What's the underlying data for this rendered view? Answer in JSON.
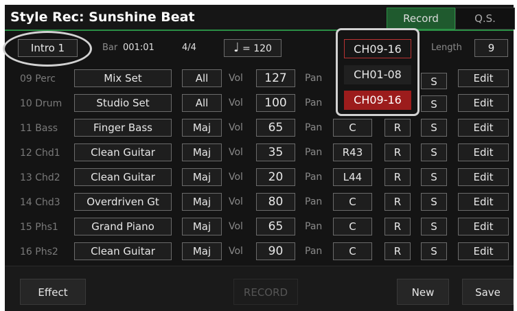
{
  "window": {
    "title": "Style Rec: Sunshine Beat"
  },
  "tabs": {
    "record": "Record",
    "qs": "Q.S."
  },
  "top": {
    "section": "Intro 1",
    "bar_label": "Bar",
    "bar_value": "001:01",
    "time_sig": "4/4",
    "tempo_symbol": "♩",
    "tempo_text": "= 120",
    "channel_range": "CH09-16",
    "length_label": "Length",
    "length_value": "9"
  },
  "channel_dropdown": {
    "options": [
      "CH01-08",
      "CH09-16"
    ],
    "selected": "CH09-16"
  },
  "labels": {
    "vol": "Vol",
    "pan": "Pan",
    "r": "R",
    "s": "S",
    "edit": "Edit"
  },
  "tracks": [
    {
      "name": "09 Perc",
      "voice": "Mix Set",
      "mode": "All",
      "vol": "127",
      "pan": ""
    },
    {
      "name": "10 Drum",
      "voice": "Studio Set",
      "mode": "All",
      "vol": "100",
      "pan": ""
    },
    {
      "name": "11 Bass",
      "voice": "Finger Bass",
      "mode": "Maj",
      "vol": "65",
      "pan": "C"
    },
    {
      "name": "12 Chd1",
      "voice": "Clean Guitar",
      "mode": "Maj",
      "vol": "35",
      "pan": "R43"
    },
    {
      "name": "13 Chd2",
      "voice": "Clean Guitar",
      "mode": "Maj",
      "vol": "20",
      "pan": "L44"
    },
    {
      "name": "14 Chd3",
      "voice": "Overdriven Gt",
      "mode": "Maj",
      "vol": "80",
      "pan": "C"
    },
    {
      "name": "15 Phs1",
      "voice": "Grand Piano",
      "mode": "Maj",
      "vol": "65",
      "pan": "C"
    },
    {
      "name": "16 Phs2",
      "voice": "Clean Guitar",
      "mode": "Maj",
      "vol": "90",
      "pan": "C"
    }
  ],
  "bottom": {
    "effect": "Effect",
    "record": "RECORD",
    "new": "New",
    "save": "Save"
  },
  "colors": {
    "accent_green": "#2b8f45",
    "selected_red": "#9c1c1c"
  }
}
